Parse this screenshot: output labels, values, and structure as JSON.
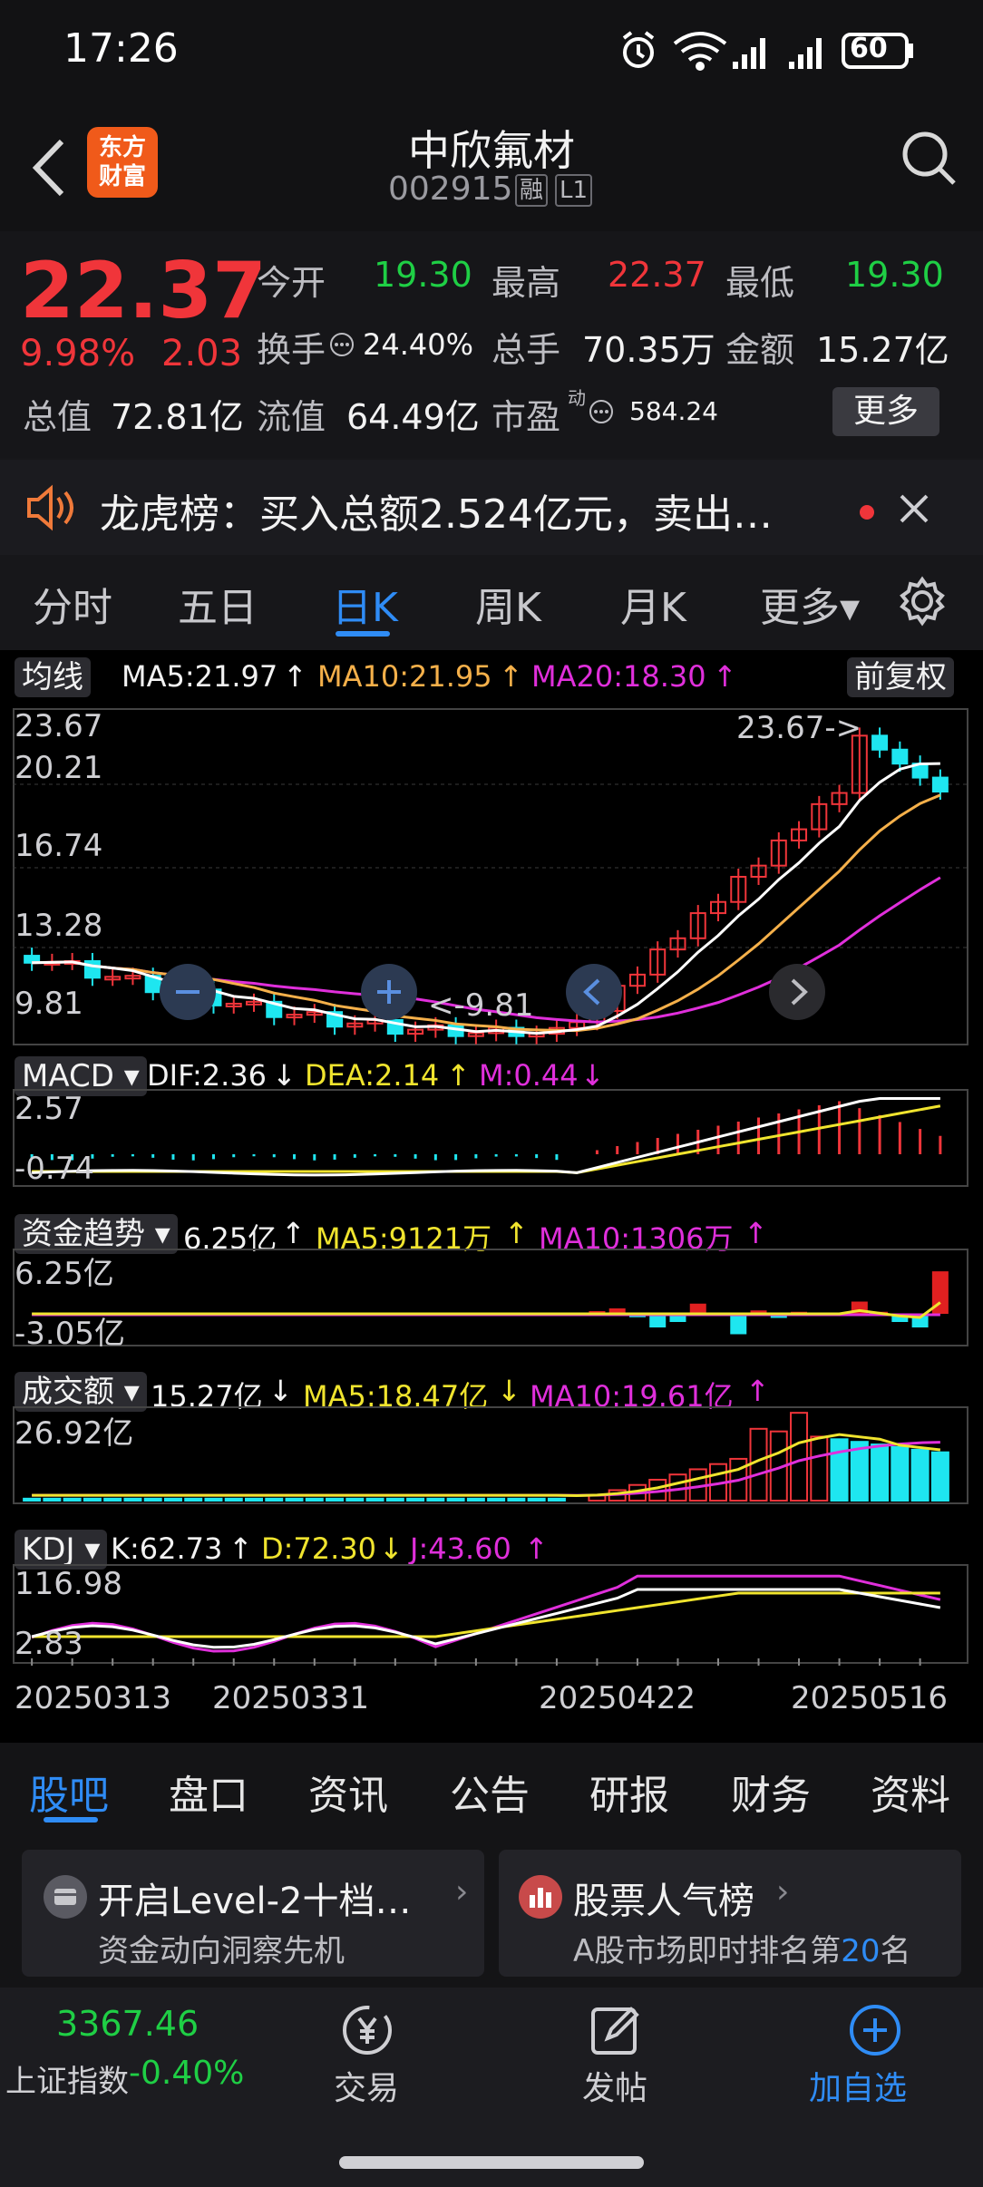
{
  "status": {
    "time": "17:26",
    "battery": "60"
  },
  "header": {
    "logo_line1": "东方",
    "logo_line2": "财富",
    "title": "中欣氟材",
    "code": "002915",
    "badge_rong": "融",
    "badge_level": "L1"
  },
  "quote": {
    "price": "22.37",
    "pct": "9.98%",
    "chg": "2.03",
    "open_lbl": "今开",
    "open": "19.30",
    "high_lbl": "最高",
    "high": "22.37",
    "low_lbl": "最低",
    "low": "19.30",
    "turnover_lbl": "换手",
    "turnover": "24.40%",
    "vol_lbl": "总手",
    "vol": "70.35万",
    "amt_lbl": "金额",
    "amt": "15.27亿",
    "mcap_lbl": "总值",
    "mcap": "72.81亿",
    "float_lbl": "流值",
    "float": "64.49亿",
    "pe_lbl": "市盈",
    "pe_sup": "动",
    "pe": "584.24",
    "more": "更多"
  },
  "notice": {
    "text": "龙虎榜：买入总额2.524亿元，卖出…"
  },
  "period_tabs": [
    "分时",
    "五日",
    "日K",
    "周K",
    "月K",
    "更多▾"
  ],
  "active_period": "日K",
  "ma_bar": {
    "label": "均线",
    "ma5": "MA5:21.97",
    "ma10": "MA10:21.95",
    "ma20": "MA20:18.30",
    "arrow": "↑",
    "adjust": "前复权"
  },
  "kline_axis": {
    "y1": "23.67",
    "y2": "20.21",
    "y3": "16.74",
    "y4": "13.28",
    "y5": "9.81",
    "high_mark": "23.67->",
    "low_mark": "<-9.81"
  },
  "macd_bar": {
    "label": "MACD",
    "dif": "DIF:2.36",
    "dea": "DEA:2.14",
    "m": "M:0.44",
    "down": "↓",
    "up": "↑",
    "y1": "2.57",
    "y2": "-0.74"
  },
  "fund_bar": {
    "label": "资金趋势",
    "v": "6.25亿",
    "ma5": "MA5:9121万",
    "ma10": "MA10:1306万",
    "up": "↑",
    "y1": "6.25亿",
    "y2": "-3.05亿"
  },
  "amount_bar": {
    "label": "成交额",
    "v": "15.27亿",
    "ma5": "MA5:18.47亿",
    "ma10": "MA10:19.61亿",
    "down": "↓",
    "up": "↑",
    "y1": "26.92亿"
  },
  "kdj_bar": {
    "label": "KDJ",
    "k": "K:62.73",
    "d": "D:72.30",
    "j": "J:43.60",
    "up": "↑",
    "down": "↓",
    "y1": "116.98",
    "y2": "2.83"
  },
  "dates": [
    "20250313",
    "20250331",
    "20250422",
    "20250516"
  ],
  "bottom_tabs": [
    "股吧",
    "盘口",
    "资讯",
    "公告",
    "研报",
    "财务",
    "资料"
  ],
  "active_bottom_tab": "股吧",
  "cards": {
    "c1_title": "开启Level-2十档…",
    "c1_sub": "资金动向洞察先机",
    "c2_title": "股票人气榜",
    "c2_sub_a": "A股市场即时排名第",
    "c2_rank": "20",
    "c2_sub_b": "名"
  },
  "nav": {
    "index_value": "3367.46",
    "index_name": "上证指数",
    "index_pct": "-0.40%",
    "trade": "交易",
    "post": "发帖",
    "add": "加自选"
  },
  "colors": {
    "up": "#f0353a",
    "down": "#1fcf45",
    "cyan": "#1ee6f0",
    "ma5": "#ffffff",
    "ma10": "#f5b04a",
    "ma20": "#e02fdb",
    "accent": "#2f8cf5"
  }
}
